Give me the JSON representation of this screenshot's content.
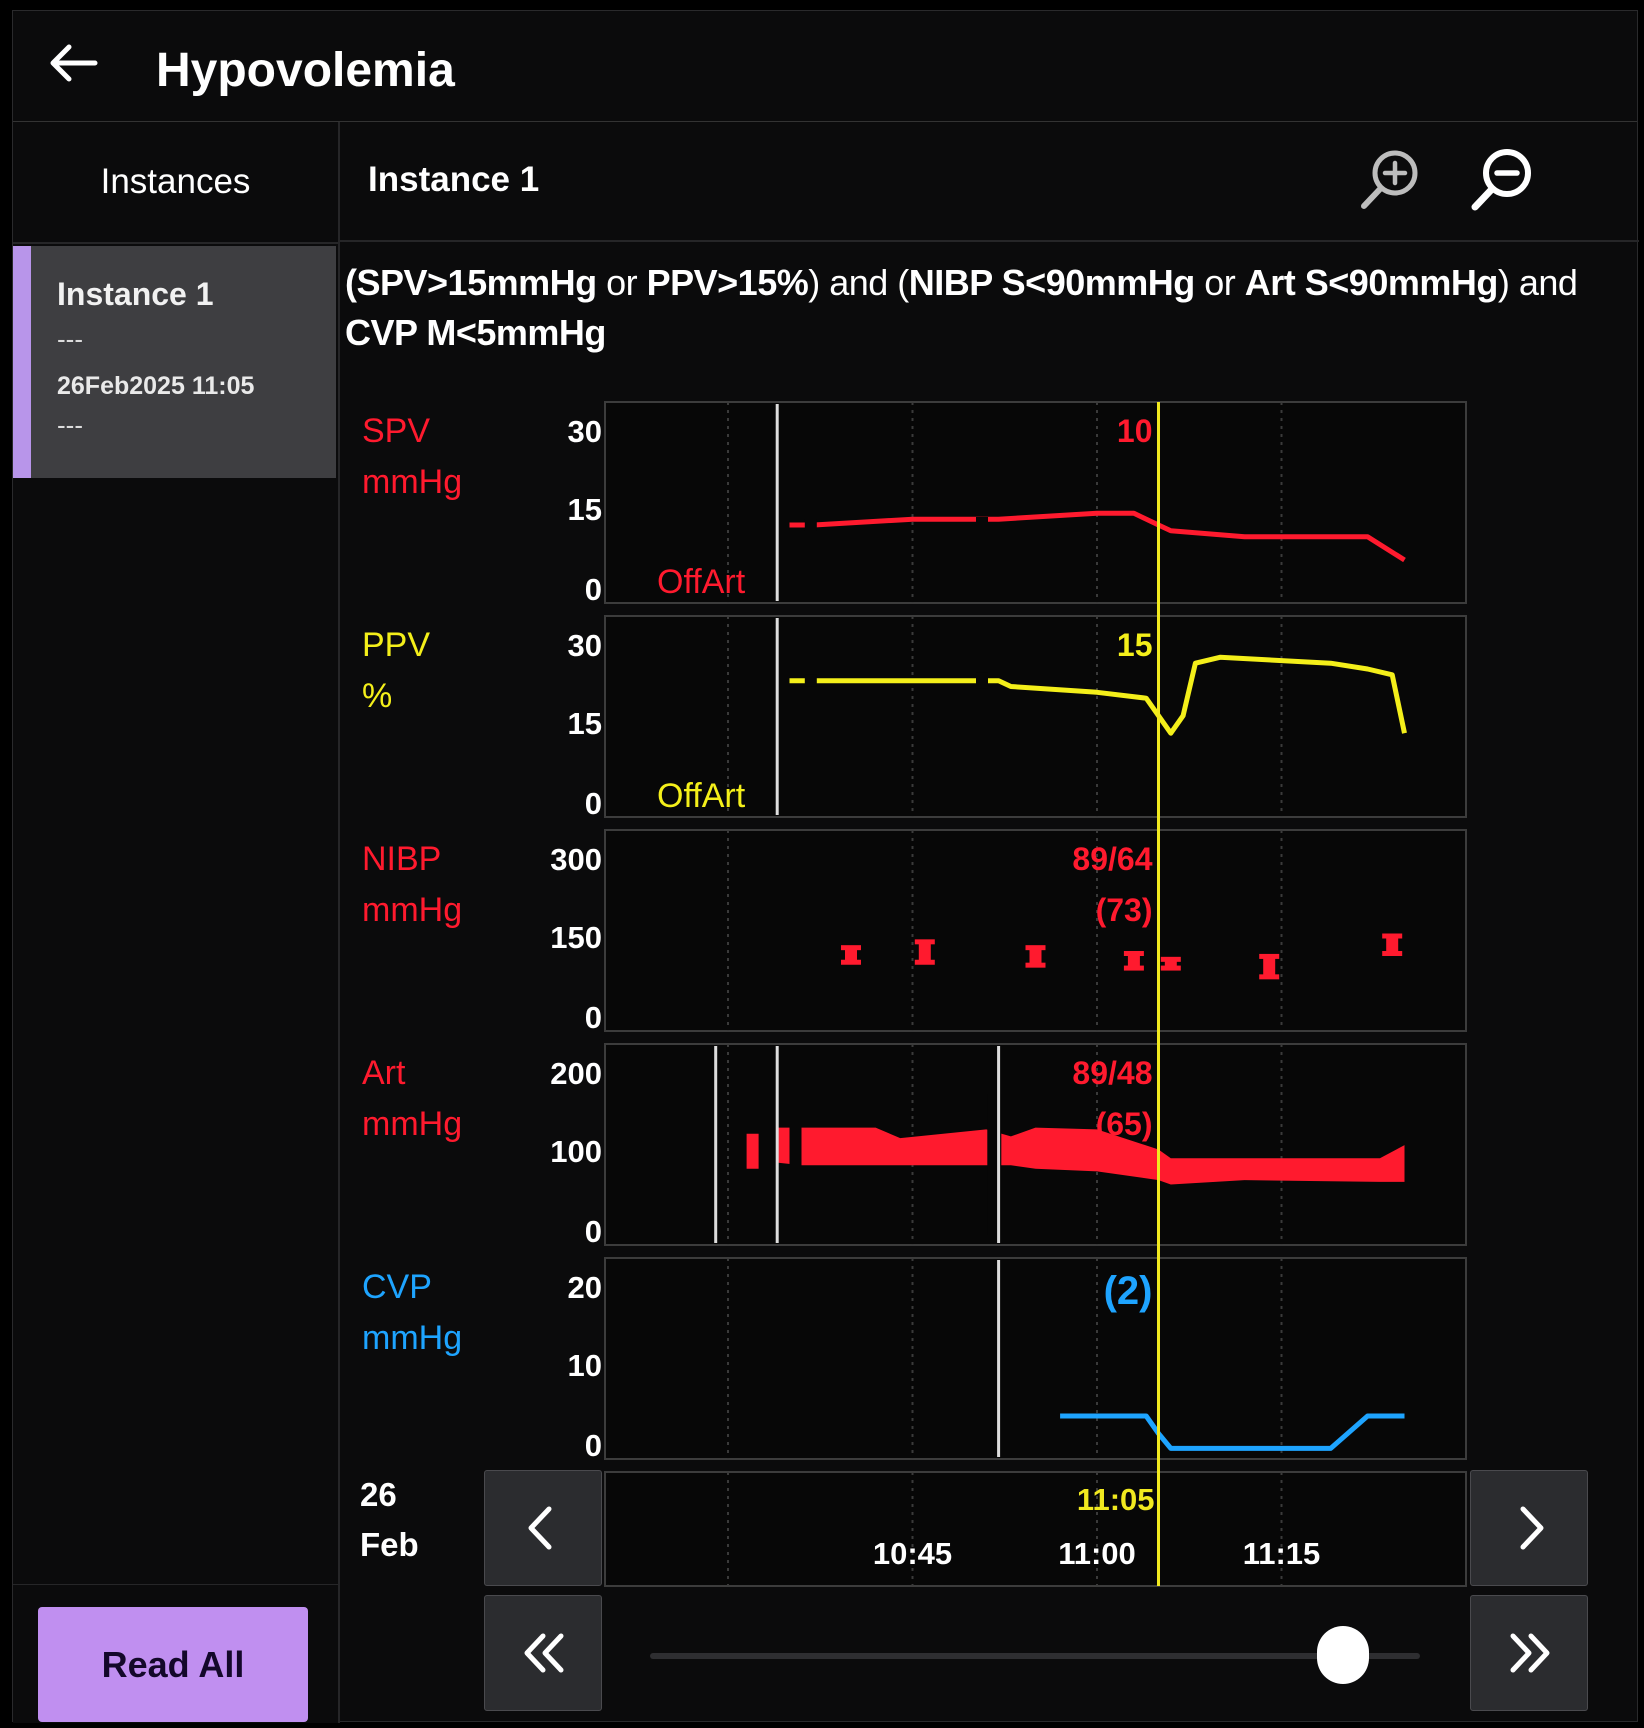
{
  "app": {
    "title": "Hypovolemia",
    "back_icon": "arrow-left-icon"
  },
  "sidebar": {
    "header": "Instances",
    "items": [
      {
        "title": "Instance 1",
        "line1": "---",
        "date": "26Feb2025 11:05",
        "line2": "---",
        "selected": true
      }
    ],
    "read_all_label": "Read All",
    "accent_color": "#b895ea",
    "button_color": "#c08ff0"
  },
  "main": {
    "heading": "Instance 1",
    "zoom_in_icon": "zoom-in-icon",
    "zoom_out_icon": "zoom-out-icon",
    "condition": {
      "line1_parts": [
        "(SPV>15mmHg",
        " or ",
        "PPV>15%",
        ") and (",
        "NIBP S<90mmHg",
        " or ",
        "Art S<90mmHg",
        ") and"
      ],
      "line2": "CVP M<5mmHg"
    }
  },
  "colors": {
    "spv": "#ff1a2e",
    "ppv": "#f4ef1a",
    "nibp": "#ff1a2e",
    "art": "#ff1a2e",
    "cvp": "#1ea4ff",
    "cursor": "#f1e91f",
    "grid": "#3a3a3a"
  },
  "chart_data": [
    {
      "type": "line",
      "name": "SPV",
      "label": "SPV",
      "unit": "mmHg",
      "y_ticks": [
        "30",
        "15",
        "0"
      ],
      "ylim": [
        0,
        30
      ],
      "cursor_value": "10",
      "status_text": "OffArt",
      "x_time": [
        "10:35",
        "10:37",
        "10:45",
        "10:50",
        "10:52",
        "11:00",
        "11:03",
        "11:05",
        "11:06",
        "11:12",
        "11:20",
        "11:22",
        "11:25"
      ],
      "y": [
        12,
        12,
        13,
        13,
        13,
        14,
        14,
        12,
        11,
        10,
        10,
        10,
        6
      ]
    },
    {
      "type": "line",
      "name": "PPV",
      "label": "PPV",
      "unit": "%",
      "y_ticks": [
        "30",
        "15",
        "0"
      ],
      "ylim": [
        0,
        30
      ],
      "cursor_value": "15",
      "status_text": "OffArt",
      "x_time": [
        "10:35",
        "10:37",
        "10:45",
        "10:50",
        "10:52",
        "10:53",
        "11:00",
        "11:04",
        "11:06",
        "11:07",
        "11:08",
        "11:10",
        "11:19",
        "11:22",
        "11:24",
        "11:25"
      ],
      "y": [
        22,
        22,
        22,
        22,
        22,
        21,
        20,
        19,
        13,
        16,
        25,
        26,
        25,
        24,
        23,
        13
      ]
    },
    {
      "type": "scatter",
      "name": "NIBP",
      "label": "NIBP",
      "unit": "mmHg",
      "y_ticks": [
        "300",
        "150",
        "0"
      ],
      "ylim": [
        0,
        300
      ],
      "cursor_value": "89/64",
      "cursor_value_mean": "(73)",
      "x_time": [
        "10:40",
        "10:46",
        "10:55",
        "11:03",
        "11:06",
        "11:14",
        "11:24"
      ],
      "systolic": [
        130,
        140,
        130,
        120,
        110,
        115,
        150
      ],
      "diastolic": [
        105,
        105,
        100,
        95,
        95,
        80,
        120
      ]
    },
    {
      "type": "area",
      "name": "Art",
      "label": "Art",
      "unit": "mmHg",
      "y_ticks": [
        "200",
        "100",
        "0"
      ],
      "ylim": [
        0,
        200
      ],
      "cursor_value": "89/48",
      "cursor_value_mean": "(65)",
      "x_time": [
        "10:34",
        "10:36",
        "10:42",
        "10:44",
        "10:51",
        "10:53",
        "10:55",
        "11:00",
        "11:05",
        "11:06",
        "11:12",
        "11:23",
        "11:25"
      ],
      "upper": [
        125,
        125,
        125,
        113,
        123,
        115,
        125,
        123,
        100,
        90,
        90,
        90,
        105
      ],
      "lower": [
        85,
        82,
        82,
        82,
        82,
        82,
        78,
        75,
        65,
        60,
        65,
        63,
        63
      ]
    },
    {
      "type": "line",
      "name": "CVP",
      "label": "CVP",
      "unit": "mmHg",
      "y_ticks": [
        "20",
        "10",
        "0"
      ],
      "ylim": [
        0,
        20
      ],
      "cursor_value": "(2)",
      "x_time": [
        "10:57",
        "11:04",
        "11:05",
        "11:06",
        "11:19",
        "11:22",
        "11:25"
      ],
      "y": [
        4,
        4,
        2,
        0.3,
        0.3,
        4,
        4
      ]
    }
  ],
  "timeline": {
    "date_day": "26",
    "date_month": "Feb",
    "cursor_time": "11:05",
    "ticks": [
      "10:45",
      "11:00",
      "11:15"
    ],
    "slider_position": 0.9
  },
  "nav": {
    "prev_icon": "chevron-left-icon",
    "next_icon": "chevron-right-icon",
    "first_icon": "double-chevron-left-icon",
    "last_icon": "double-chevron-right-icon"
  }
}
